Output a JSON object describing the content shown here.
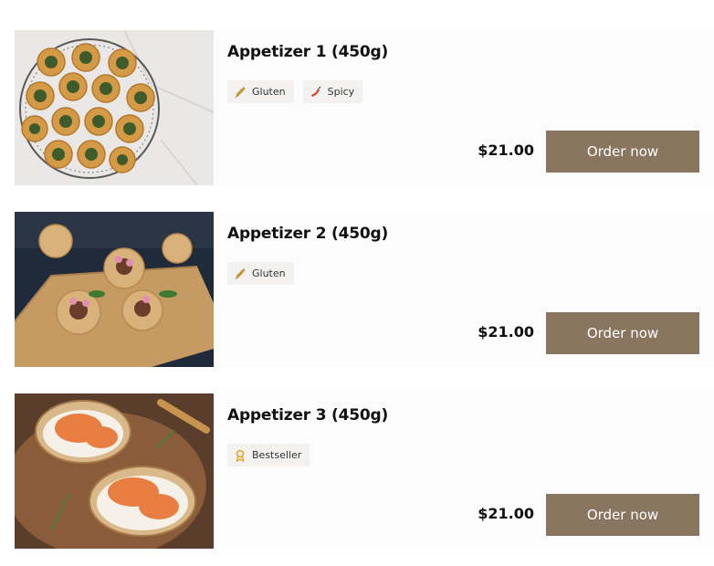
{
  "menu": {
    "items": [
      {
        "title": "Appetizer 1 (450g)",
        "tags": [
          {
            "label": "Gluten",
            "icon": "wheat-icon"
          },
          {
            "label": "Spicy",
            "icon": "chili-pepper-icon"
          }
        ],
        "price": "$21.00",
        "order_label": "Order now"
      },
      {
        "title": "Appetizer 2 (450g)",
        "tags": [
          {
            "label": "Gluten",
            "icon": "wheat-icon"
          }
        ],
        "price": "$21.00",
        "order_label": "Order now"
      },
      {
        "title": "Appetizer 3 (450g)",
        "tags": [
          {
            "label": "Bestseller",
            "icon": "award-ribbon-icon"
          }
        ],
        "price": "$21.00",
        "order_label": "Order now"
      }
    ]
  },
  "colors": {
    "button_bg": "#8a7560",
    "tag_bg": "#f3f2f1",
    "wheat": "#c9a24a",
    "chili": "#d63b2f",
    "award": "#e0a81f"
  }
}
